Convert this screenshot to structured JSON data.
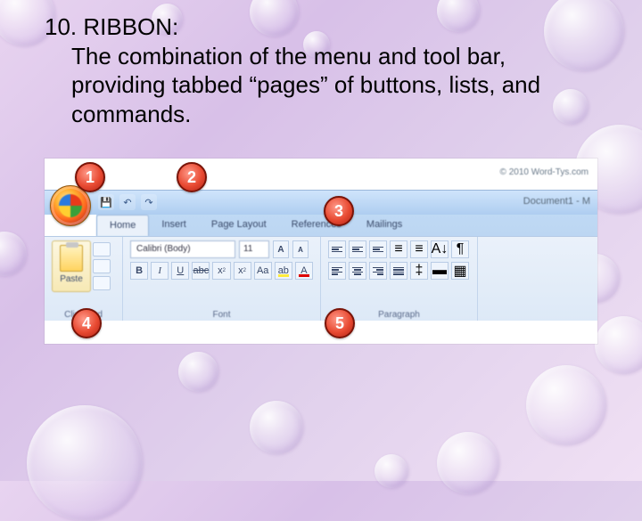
{
  "slide": {
    "title": "10. RIBBON:",
    "description": "The combination of the menu and tool bar, providing tabbed “pages” of buttons, lists, and commands."
  },
  "callouts": {
    "c1": "1",
    "c2": "2",
    "c3": "3",
    "c4": "4",
    "c5": "5"
  },
  "copyright": "© 2010 Word-Tys.com",
  "document_title": "Document1 - M",
  "tabs": [
    "Home",
    "Insert",
    "Page Layout",
    "References",
    "Mailings"
  ],
  "groups": {
    "clipboard": "Clipboard",
    "font": "Font",
    "paragraph": "Paragraph"
  },
  "paste_label": "Paste",
  "font": {
    "name": "Calibri (Body)",
    "size": "11"
  }
}
